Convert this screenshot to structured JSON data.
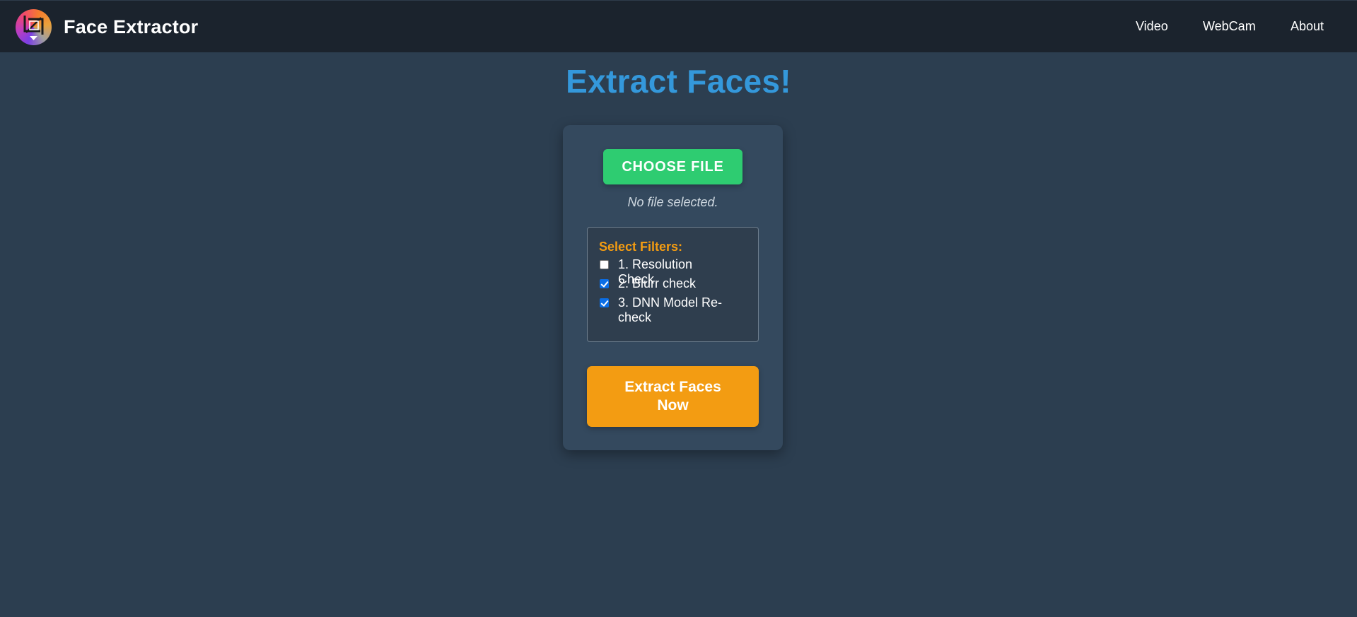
{
  "navbar": {
    "brand_title": "Face Extractor",
    "logo_icon": "face-crop-logo-icon",
    "links": {
      "video": "Video",
      "webcam": "WebCam",
      "about": "About"
    }
  },
  "main": {
    "title": "Extract Faces!",
    "file_picker": {
      "button_label": "CHOOSE FILE",
      "status": "No file selected."
    },
    "filters": {
      "title": "Select Filters:",
      "items": [
        {
          "label": "1. Resolution Check",
          "checked": false
        },
        {
          "label": "2. Blurr check",
          "checked": true
        },
        {
          "label": "3. DNN Model Re-check",
          "checked": true
        }
      ]
    },
    "submit_label": "Extract Faces Now"
  },
  "colors": {
    "background": "#2c3e50",
    "navbar": "#1b232d",
    "card": "#34495e",
    "title_blue": "#3498db",
    "choose_green": "#2ecc71",
    "accent_orange": "#f39c12",
    "checkbox_blue": "#0b6ee6"
  }
}
